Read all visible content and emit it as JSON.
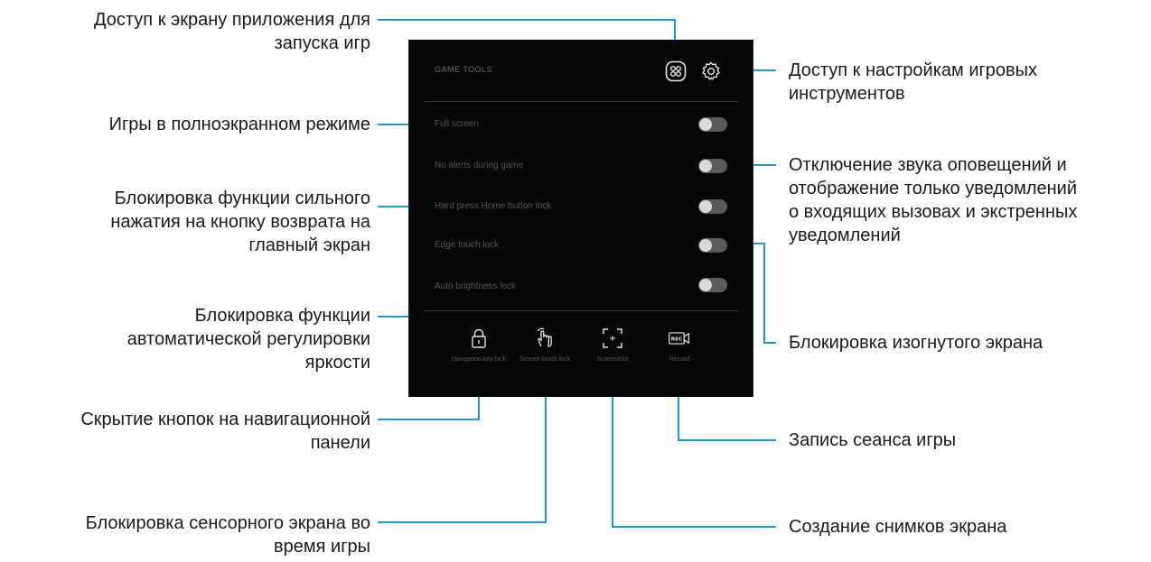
{
  "panel": {
    "title": "GAME TOOLS",
    "rows": [
      {
        "label": "Full screen"
      },
      {
        "label": "No alerts during game"
      },
      {
        "label": "Hard press Home button lock"
      },
      {
        "label": "Edge touch lock"
      },
      {
        "label": "Auto brightness lock"
      }
    ],
    "bottom": [
      {
        "label": "Navigation key lock",
        "icon": "lock-icon"
      },
      {
        "label": "Screen touch lock",
        "icon": "touch-hand-icon"
      },
      {
        "label": "Screenshot",
        "icon": "screenshot-icon"
      },
      {
        "label": "Record",
        "icon": "rec-camera-icon",
        "badge": "REC"
      }
    ],
    "header_icons": [
      "game-launcher-icon",
      "gear-icon"
    ]
  },
  "callouts": {
    "launcher": "Доступ к экрану приложения для запуска игр",
    "fullscreen": "Игры в полноэкранном режиме",
    "home_lock": "Блокировка функции сильного нажатия на кнопку возврата на главный экран",
    "brightness": "Блокировка функции автоматической регулировки яркости",
    "navbar": "Скрытие кнопок на навигационной панели",
    "touch_lock": "Блокировка сенсорного экрана во время игры",
    "settings": "Доступ к настройкам игровых инструментов",
    "alerts": "Отключение звука оповещений и отображение только уведомлений о входящих вызовах и экстренных уведомлений",
    "edge_lock": "Блокировка изогнутого экрана",
    "record": "Запись сеанса игры",
    "screenshot": "Создание снимков экрана"
  },
  "callout_lines": {
    "launcher": [
      "Доступ к экрану приложения для",
      "запуска игр"
    ],
    "fullscreen": [
      "Игры в полноэкранном режиме"
    ],
    "home_lock": [
      "Блокировка функции сильного",
      "нажатия на кнопку возврата на",
      "главный экран"
    ],
    "brightness": [
      "Блокировка функции",
      "автоматической регулировки",
      "яркости"
    ],
    "navbar": [
      "Скрытие кнопок на навигационной",
      "панели"
    ],
    "touch_lock": [
      "Блокировка сенсорного экрана во",
      "время игры"
    ],
    "settings": [
      "Доступ к настройкам игровых",
      "инструментов"
    ],
    "alerts": [
      "Отключение звука оповещений и",
      "отображение только уведомлений",
      "о входящих вызовах и экстренных",
      "уведомлений"
    ],
    "edge_lock": [
      "Блокировка изогнутого экрана"
    ],
    "record": [
      "Запись сеанса игры"
    ],
    "screenshot": [
      "Создание снимков экрана"
    ]
  },
  "colors": {
    "accent_line": "#1a9ad6",
    "panel_bg": "#070707",
    "text": "#1a1a1a"
  }
}
